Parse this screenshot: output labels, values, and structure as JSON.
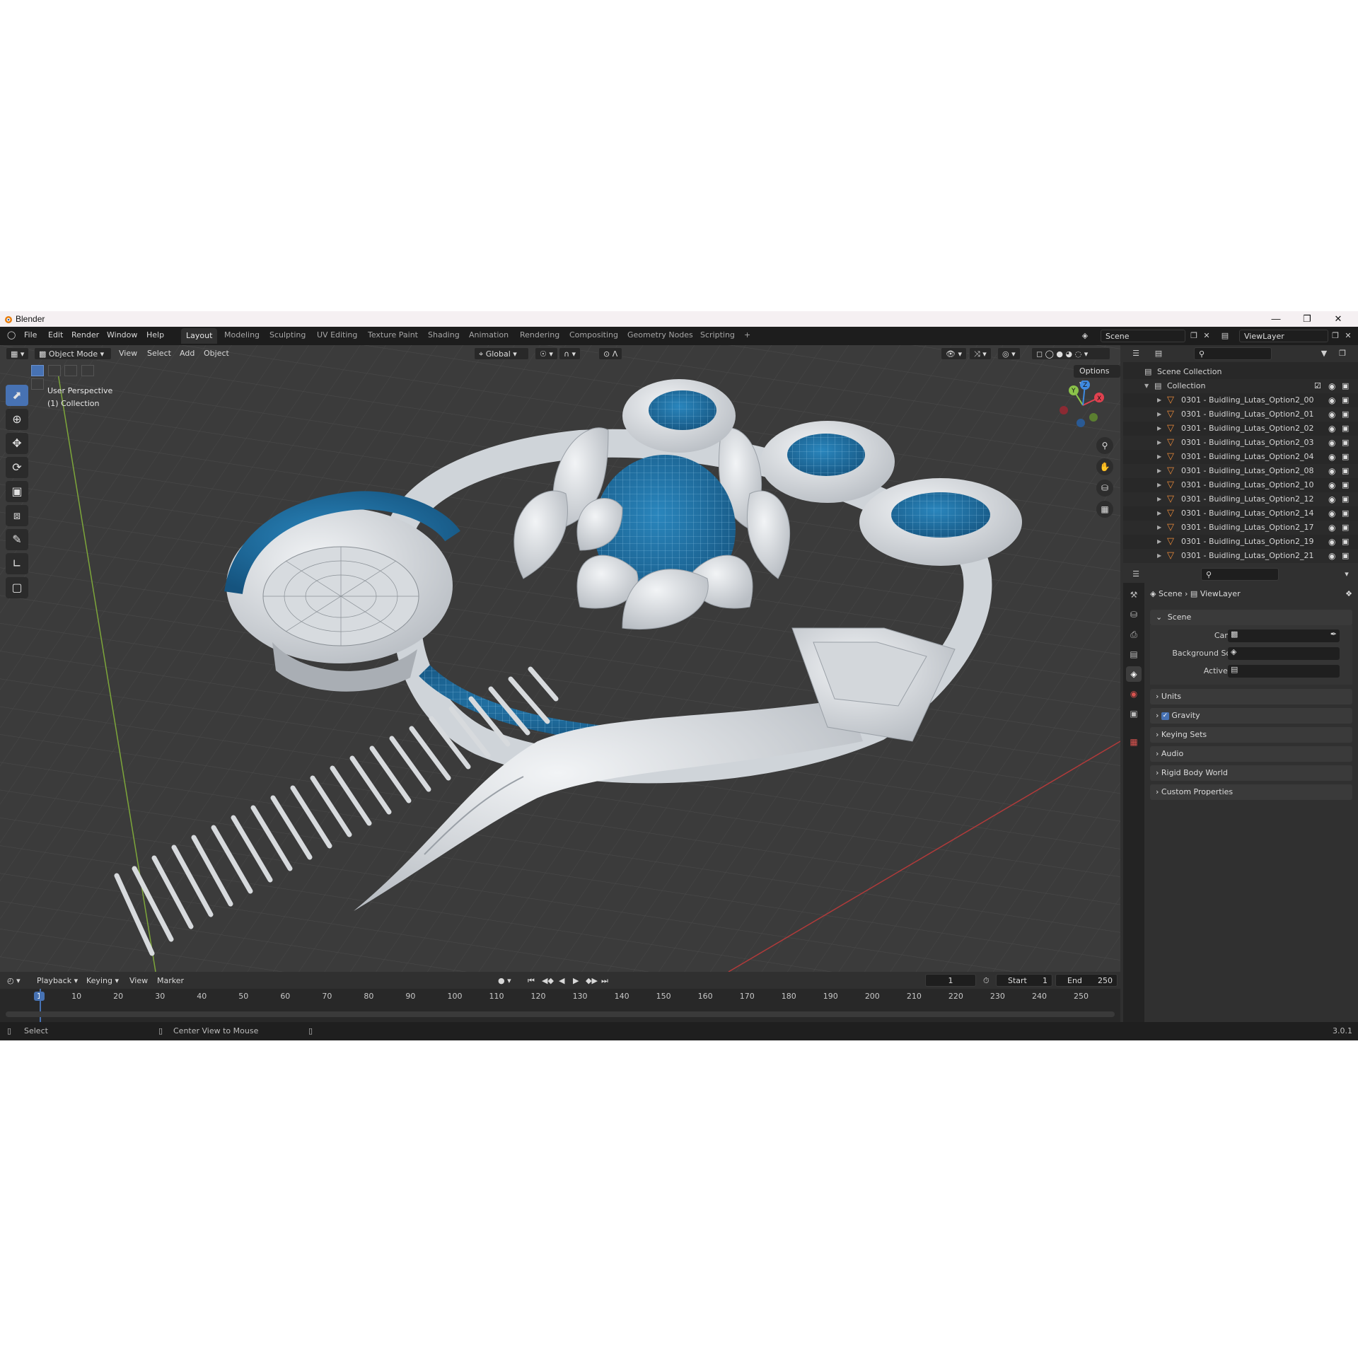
{
  "window": {
    "title": "Blender"
  },
  "menu": [
    "File",
    "Edit",
    "Render",
    "Window",
    "Help"
  ],
  "workspaces": [
    {
      "label": "Layout",
      "active": true
    },
    {
      "label": "Modeling"
    },
    {
      "label": "Sculpting"
    },
    {
      "label": "UV Editing"
    },
    {
      "label": "Texture Paint"
    },
    {
      "label": "Shading"
    },
    {
      "label": "Animation"
    },
    {
      "label": "Rendering"
    },
    {
      "label": "Compositing"
    },
    {
      "label": "Geometry Nodes"
    },
    {
      "label": "Scripting"
    }
  ],
  "add_workspace": "+",
  "scene_field": "Scene",
  "viewlayer_field": "ViewLayer",
  "viewport": {
    "mode": "Object Mode",
    "menus": [
      "View",
      "Select",
      "Add",
      "Object"
    ],
    "transform_orientation": "Global",
    "options": "Options",
    "overlay_line1": "User Perspective",
    "overlay_line2": "(1) Collection",
    "gizmo_axes": [
      "X",
      "Y",
      "Z"
    ]
  },
  "outliner": {
    "root": "Scene Collection",
    "collection": "Collection",
    "items": [
      "0301 - Buidling_Lutas_Option2_00",
      "0301 - Buidling_Lutas_Option2_01",
      "0301 - Buidling_Lutas_Option2_02",
      "0301 - Buidling_Lutas_Option2_03",
      "0301 - Buidling_Lutas_Option2_04",
      "0301 - Buidling_Lutas_Option2_08",
      "0301 - Buidling_Lutas_Option2_10",
      "0301 - Buidling_Lutas_Option2_12",
      "0301 - Buidling_Lutas_Option2_14",
      "0301 - Buidling_Lutas_Option2_17",
      "0301 - Buidling_Lutas_Option2_19",
      "0301 - Buidling_Lutas_Option2_21"
    ]
  },
  "properties": {
    "breadcrumb_scene": "Scene",
    "breadcrumb_sep": "›",
    "breadcrumb_viewlayer": "ViewLayer",
    "panel_scene": "Scene",
    "camera_label": "Camera",
    "background_scene_label": "Background Scene",
    "active_clip_label": "Active Clip",
    "panels": [
      "Units",
      "Gravity",
      "Keying Sets",
      "Audio",
      "Rigid Body World",
      "Custom Properties"
    ],
    "gravity_checked": true
  },
  "timeline": {
    "menus": [
      "Playback",
      "Keying",
      "View",
      "Marker"
    ],
    "current_frame": "1",
    "start_label": "Start",
    "start_value": "1",
    "end_label": "End",
    "end_value": "250",
    "frame_ticks": [
      "1",
      "10",
      "20",
      "30",
      "40",
      "50",
      "60",
      "70",
      "80",
      "90",
      "100",
      "110",
      "120",
      "130",
      "140",
      "150",
      "160",
      "170",
      "180",
      "190",
      "200",
      "210",
      "220",
      "230",
      "240",
      "250"
    ]
  },
  "status": {
    "left": "Select",
    "middle": "Center View to Mouse",
    "version": "3.0.1"
  },
  "colors": {
    "accent": "#4772b3",
    "glass_blue": "#1f6fa3",
    "mesh_orange": "#e8893a",
    "axis_x": "#e0414f",
    "axis_y": "#8bc34a",
    "axis_z": "#3f8ae0"
  }
}
